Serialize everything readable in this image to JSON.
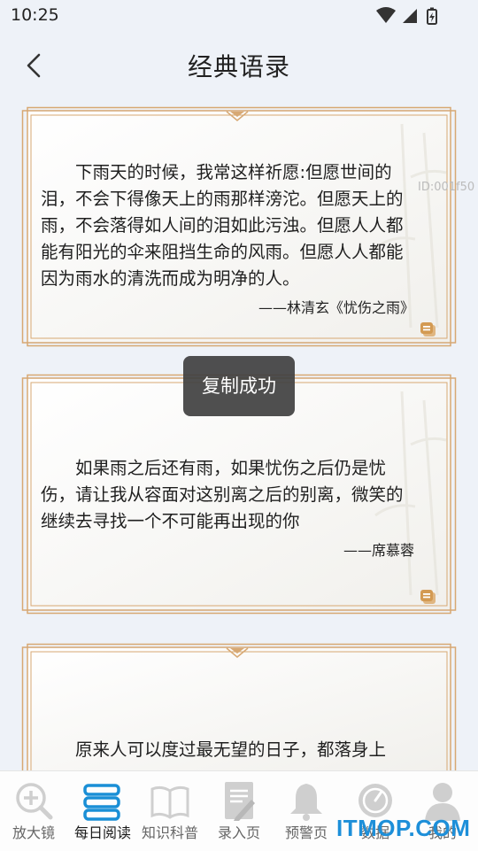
{
  "status": {
    "time": "10:25"
  },
  "header": {
    "title": "经典语录"
  },
  "cards": [
    {
      "text": "下雨天的时候，我常这样祈愿:但愿世间的泪，不会下得像天上的雨那样滂沱。但愿天上的雨，不会落得如人间的泪如此污浊。但愿人人都能有阳光的伞来阻挡生命的风雨。但愿人人都能因为雨水的清洗而成为明净的人。",
      "author": "——林清玄《忧伤之雨》"
    },
    {
      "text": "如果雨之后还有雨，如果忧伤之后仍是忧伤，请让我从容面对这别离之后的别离，微笑的继续去寻找一个不可能再出现的你",
      "author": "——席慕蓉"
    },
    {
      "text": "原来人可以度过最无望的日子，都落身上",
      "author": ""
    }
  ],
  "toast": {
    "text": "复制成功"
  },
  "overlay_id": "ID:001f50",
  "nav": {
    "items": [
      {
        "label": "放大镜"
      },
      {
        "label": "每日阅读"
      },
      {
        "label": "知识科普"
      },
      {
        "label": "录入页"
      },
      {
        "label": "预警页"
      },
      {
        "label": "数据"
      },
      {
        "label": "我的"
      }
    ]
  },
  "watermark": "ITMOP.COM",
  "colors": {
    "accent": "#1a8fd6",
    "card_border": "#d7a873",
    "toast_bg": "#404040"
  }
}
